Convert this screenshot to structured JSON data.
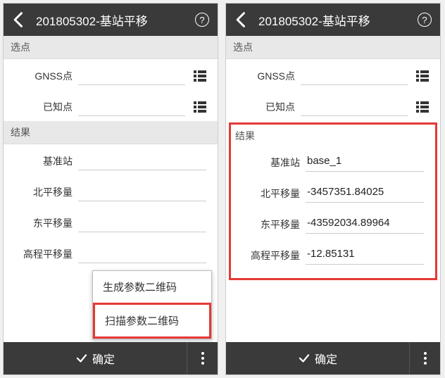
{
  "header": {
    "title": "201805302-基站平移",
    "back_icon": "back-icon",
    "help_label": "?"
  },
  "sections": {
    "select_point": "选点",
    "result": "结果"
  },
  "fields": {
    "gnss_label": "GNSS点",
    "known_label": "已知点",
    "base_label": "基准站",
    "north_label": "北平移量",
    "east_label": "东平移量",
    "height_label": "高程平移量"
  },
  "left": {
    "gnss": "",
    "known": "",
    "base": "",
    "north": "",
    "east": "",
    "height": ""
  },
  "right": {
    "gnss": "",
    "known": "",
    "base": "base_1",
    "north": "-3457351.84025",
    "east": "-43592034.89964",
    "height": "-12.85131"
  },
  "popup": {
    "gen_qr": "生成参数二维码",
    "scan_qr": "扫描参数二维码"
  },
  "footer": {
    "confirm": "确定"
  }
}
